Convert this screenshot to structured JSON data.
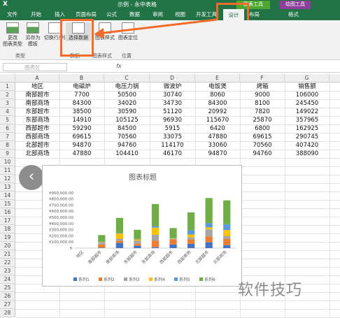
{
  "app": {
    "logo": "X",
    "title": "示例 - 永中表格",
    "context_tool_1": "图表工具",
    "context_tool_2": "绘图工具"
  },
  "tabs": {
    "file": "文件",
    "home": "开始",
    "insert": "插入",
    "layout": "页面布局",
    "formulas": "公式",
    "data": "数据",
    "review": "审阅",
    "view": "视图",
    "developer": "开发工具",
    "design": "设计",
    "chart_layout": "布局",
    "format": "格式"
  },
  "ribbon": {
    "change_type": "更改\n图表类型",
    "save_template": "另存为\n模板",
    "switch_row_col": "切换行/列",
    "select_data": "选择数据",
    "chart_style": "图表样式",
    "move_chart": "图表定位",
    "group_type": "类型",
    "group_data": "数据",
    "group_style": "图表样式",
    "group_location": "位置"
  },
  "formula_bar": {
    "name_box": "图表区",
    "fx": "fx"
  },
  "columns": [
    "A",
    "B",
    "C",
    "D",
    "E",
    "F",
    "G"
  ],
  "table": {
    "header": [
      "地区",
      "电磁炉",
      "电压力锅",
      "微波炉",
      "电饭煲",
      "烤箱",
      "销售额"
    ],
    "rows": [
      [
        "南部超市",
        "7700",
        "50500",
        "30740",
        "8060",
        "9000",
        "106000"
      ],
      [
        "南部商场",
        "84300",
        "34020",
        "34730",
        "84300",
        "8100",
        "245450"
      ],
      [
        "东部超市",
        "38500",
        "30590",
        "51120",
        "20992",
        "7820",
        "149022"
      ],
      [
        "东部商场",
        "14910",
        "105125",
        "96930",
        "115670",
        "25870",
        "357965"
      ],
      [
        "西部超市",
        "59290",
        "84500",
        "5915",
        "6420",
        "6800",
        "162925"
      ],
      [
        "西部商场",
        "69615",
        "70560",
        "33075",
        "47880",
        "69615",
        "290745"
      ],
      [
        "北部超市",
        "94870",
        "94760",
        "114170",
        "33060",
        "70560",
        "407420"
      ],
      [
        "北部商场",
        "47880",
        "104410",
        "46170",
        "94870",
        "94760",
        "388090"
      ]
    ]
  },
  "row_numbers": [
    "1",
    "2",
    "3",
    "4",
    "5",
    "6",
    "7",
    "8",
    "9",
    "10",
    "11",
    "12",
    "13",
    "14",
    "15",
    "16",
    "17",
    "18",
    "19",
    "20",
    "21",
    "22",
    "23",
    "24",
    "25",
    "26",
    "27",
    "28"
  ],
  "chart_data": {
    "type": "bar",
    "stacked": true,
    "title": "图表标题",
    "categories": [
      "地区",
      "南部超市",
      "南部商场",
      "东部超市",
      "东部商场",
      "西部超市",
      "西部商场",
      "北部超市",
      "北部商场"
    ],
    "series": [
      {
        "name": "系列1",
        "values": [
          0,
          7700,
          84300,
          38500,
          14910,
          59290,
          69615,
          94870,
          47880
        ],
        "color": "#4472c4"
      },
      {
        "name": "系列2",
        "values": [
          0,
          50500,
          34020,
          30590,
          105125,
          84500,
          70560,
          94760,
          104410
        ],
        "color": "#ed7d31"
      },
      {
        "name": "系列3",
        "values": [
          0,
          30740,
          34730,
          51120,
          96930,
          5915,
          33075,
          114170,
          46170
        ],
        "color": "#a5a5a5"
      },
      {
        "name": "系列4",
        "values": [
          0,
          8060,
          84300,
          20992,
          115670,
          6420,
          47880,
          33060,
          94870
        ],
        "color": "#ffc000"
      },
      {
        "name": "系列5",
        "values": [
          0,
          9000,
          8100,
          7820,
          25870,
          6800,
          69615,
          70560,
          94760
        ],
        "color": "#5b9bd5"
      },
      {
        "name": "系列6",
        "values": [
          0,
          106000,
          245450,
          149022,
          357965,
          162925,
          290745,
          407420,
          388090
        ],
        "color": "#70ad47"
      }
    ],
    "ylim": [
      0,
      1000000
    ],
    "yticks": [
      "¥900,000.00",
      "¥800,000.00",
      "¥700,000.00",
      "¥600,000.00",
      "¥500,000.00",
      "¥400,000.00",
      "¥300,000.00",
      "¥200,000.00",
      "¥100,000.00",
      "¥-"
    ],
    "legend": "bottom",
    "grid": false
  },
  "watermark": "软件技巧",
  "colors": {
    "excel_green": "#217346",
    "highlight": "#f26b2a",
    "chart_tool": "#4ea72e",
    "draw_tool": "#8e3e9c"
  }
}
